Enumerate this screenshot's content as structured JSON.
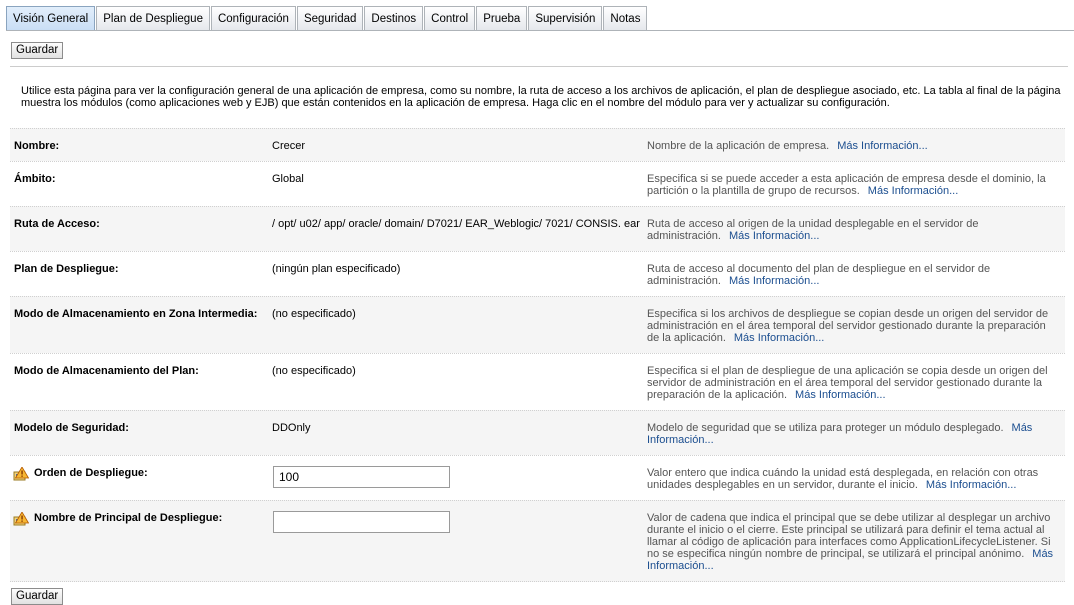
{
  "tabs": [
    {
      "label": "Visión General",
      "active": true
    },
    {
      "label": "Plan de Despliegue",
      "active": false
    },
    {
      "label": "Configuración",
      "active": false
    },
    {
      "label": "Seguridad",
      "active": false
    },
    {
      "label": "Destinos",
      "active": false
    },
    {
      "label": "Control",
      "active": false
    },
    {
      "label": "Prueba",
      "active": false
    },
    {
      "label": "Supervisión",
      "active": false
    },
    {
      "label": "Notas",
      "active": false
    }
  ],
  "save_label": "Guardar",
  "intro": "Utilice esta página para ver la configuración general de una aplicación de empresa, como su nombre, la ruta de acceso a los archivos de aplicación, el plan de despliegue asociado, etc. La tabla al final de la página muestra los módulos (como aplicaciones web y EJB) que están contenidos en la aplicación de empresa. Haga clic en el nombre del módulo para ver y actualizar su configuración.",
  "more_info": "Más Información...",
  "icon_name": "config-change-warning-icon",
  "colors": {
    "link": "#1a4d8f",
    "description": "#555555",
    "row_alt": "#f5f5f5"
  },
  "rows": [
    {
      "label": "Nombre:",
      "value": "Crecer",
      "desc": "Nombre de la aplicación de empresa."
    },
    {
      "label": "Ámbito:",
      "value": "Global",
      "desc": "Especifica si se puede acceder a esta aplicación de empresa desde el dominio, la partición o la plantilla de grupo de recursos."
    },
    {
      "label": "Ruta de Acceso:",
      "value": "/ opt/ u02/ app/ oracle/ domain/ D7021/ EAR_Weblogic/ 7021/ CONSIS. ear",
      "desc": "Ruta de acceso al origen de la unidad desplegable en el servidor de administración."
    },
    {
      "label": "Plan de Despliegue:",
      "value": "(ningún plan especificado)",
      "desc": "Ruta de acceso al documento del plan de despliegue en el servidor de administración."
    },
    {
      "label": "Modo de Almacenamiento en Zona Intermedia:",
      "value": "(no especificado)",
      "desc": "Especifica si los archivos de despliegue se copian desde un origen del servidor de administración en el área temporal del servidor gestionado durante la preparación de la aplicación."
    },
    {
      "label": "Modo de Almacenamiento del Plan:",
      "value": "(no especificado)",
      "desc": "Especifica si el plan de despliegue de una aplicación se copia desde un origen del servidor de administración en el área temporal del servidor gestionado durante la preparación de la aplicación."
    },
    {
      "label": "Modelo de Seguridad:",
      "value": "DDOnly",
      "desc": "Modelo de seguridad que se utiliza para proteger un módulo desplegado."
    },
    {
      "label": "Orden de Despliegue:",
      "input_value": "100",
      "desc": "Valor entero que indica cuándo la unidad está desplegada, en relación con otras unidades desplegables en un servidor, durante el inicio."
    },
    {
      "label": "Nombre de Principal de Despliegue:",
      "input_value": "",
      "desc": "Valor de cadena que indica el principal que se debe utilizar al desplegar un archivo durante el inicio o el cierre. Este principal se utilizará para definir el tema actual al llamar al código de aplicación para interfaces como ApplicationLifecycleListener. Si no se especifica ningún nombre de principal, se utilizará el principal anónimo."
    }
  ]
}
